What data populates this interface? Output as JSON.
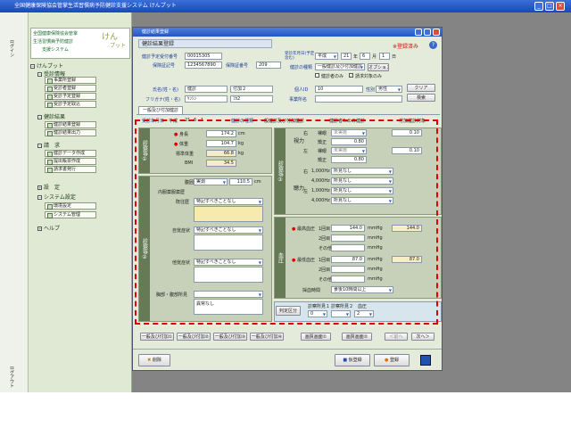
{
  "app": {
    "title": "全国健康保険協会管掌生活習慣病予防健診支援システム けんプット",
    "logo_l1": "全国健康保険協会管掌",
    "logo_l2": "生活習慣病予防健診",
    "logo_l3": "支援システム",
    "logo_brand": "けん",
    "logo_brand2": "プット",
    "strip_label": "ログイン",
    "strip_label2": "ログアウト"
  },
  "nav": {
    "root": "けんプット",
    "groups": [
      {
        "label": "受診情報",
        "items": [
          "事業所登録",
          "受診者登録",
          "受診予定登録",
          "受診予定取込"
        ]
      },
      {
        "label": "健診結果",
        "items": [
          "健診結果登録",
          "健診結果出力"
        ]
      },
      {
        "label": "請　求",
        "items": [
          "健診データ作成",
          "提出帳票作成",
          "請求書発行"
        ]
      },
      {
        "label": "設　定"
      },
      {
        "label": "システム設定",
        "items": [
          "環境設定",
          "システム管理"
        ]
      },
      {
        "label": "ヘルプ"
      }
    ]
  },
  "win": {
    "title": "健診結果登録",
    "section": "健診結果登録",
    "status": "※登録済み"
  },
  "form": {
    "no_label": "健診予定受付番号",
    "no": "00015305",
    "insurer_label": "保険証記号",
    "insurer": "1234567890",
    "insno_label": "保険証番号",
    "insno": "209",
    "date_label": "受診年月日(予定含む)",
    "era": "平成",
    "year": "21",
    "year_unit": "年",
    "month": "6",
    "month_unit": "月",
    "day": "1",
    "day_unit": "日",
    "type_label": "健診の種類",
    "type": "一般健診及び付加健診",
    "option_btn": "オプション",
    "chk1": "健診者のみ",
    "chk2": "請求対象のみ",
    "name_label": "氏名(姓・名)",
    "sei": "健診",
    "mei": "付加２",
    "kana_label": "フリガナ(姓・名)",
    "kana": "ｹﾝｼﾝ",
    "kana2": "ﾌｶ2",
    "id_label": "個人ID",
    "id": "10",
    "sex_label": "性別",
    "sex": "男性",
    "office_label": "事業所名",
    "clear_btn": "クリア",
    "search_btn": "検索"
  },
  "tabs": {
    "main": "一般及び付加健診"
  },
  "subrow": {
    "date": "受診年月日",
    "era": "平成",
    "y": "21",
    "m": "6",
    "d": "1",
    "type": "健診の種類",
    "typeval": "一般健診及び付加健診",
    "chk": "健診者ための健診",
    "chk2": "付加健診対象"
  },
  "body": {
    "section": "診察等①",
    "height": "身長",
    "height_v": "174.2",
    "weight": "体重",
    "weight_v": "104.7",
    "std": "標準体重",
    "std_v": "66.8",
    "bmi": "BMI",
    "bmi_v": "34.5",
    "unit_cm": "cm",
    "unit_kg": "kg",
    "waist": "腹囲",
    "waist_sel": "実測",
    "waist_v": "110.5"
  },
  "exam": {
    "section": "診察等②",
    "inner": "内服薬服薬歴",
    "hist": "既往歴",
    "hist_v": "特記すべきことなし",
    "subj": "自覚症状",
    "subj_v": "特記すべきことなし",
    "obj": "他覚症状",
    "obj_v": "特記すべきことなし",
    "chest": "胸部・腹部所見",
    "chest_v": "異常なし"
  },
  "vision": {
    "section": "診察等③",
    "right": "右",
    "left": "左",
    "naked": "裸眼",
    "corr": "矯正",
    "r_naked": "未実施",
    "r_corr": "0.80",
    "l_naked": "未実施",
    "l_corr": "0.80",
    "r_val": "0.10",
    "l_val": "0.10",
    "vlabel": "視力"
  },
  "hearing": {
    "label": "聴力",
    "r": "右",
    "l": "左",
    "f1": "1,000Hz",
    "f4": "4,000Hz",
    "v": "所見なし"
  },
  "bp": {
    "section": "血圧",
    "sys": "最高血圧",
    "dia": "最低血圧",
    "t1": "1回目",
    "t2": "2回目",
    "other": "その他",
    "sys1": "144.0",
    "sys_avg": "144.0",
    "dia1": "87.0",
    "dia_avg": "87.0",
    "unit": "mmHg",
    "meal_label": "採血時間",
    "meal": "食後10時間以上"
  },
  "judge": {
    "label": "判定区分",
    "l1": "診察所見１",
    "l2": "診察所見２",
    "l3": "血圧",
    "v1": "0",
    "v2": "",
    "v3": "2"
  },
  "bottom_tabs": [
    "一般及び付加①",
    "一般及び付加②",
    "一般及び付加③",
    "一般及び付加④",
    "画質画面①",
    "画質画面②",
    "＜前へ",
    "次へ＞"
  ],
  "footer": {
    "delete": "削除",
    "temp": "仮登録",
    "save": "登録"
  }
}
